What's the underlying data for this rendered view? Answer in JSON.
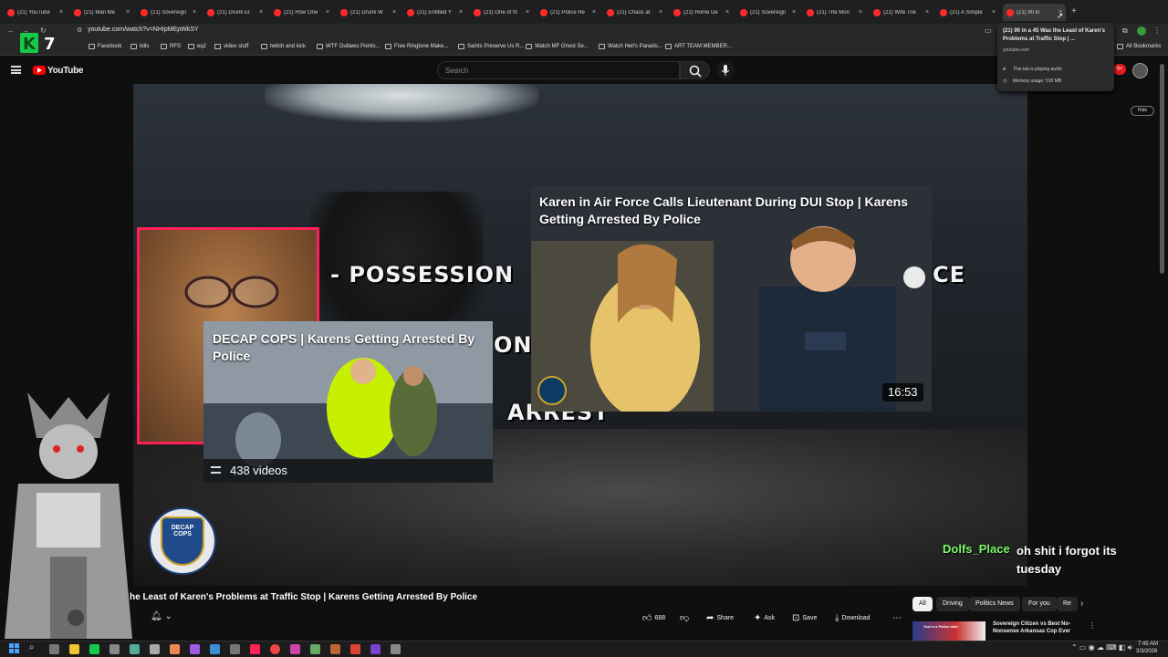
{
  "browser": {
    "tabs": [
      {
        "title": "(21) YouTube"
      },
      {
        "title": "(21) Man Me"
      },
      {
        "title": "(21) Sovereign"
      },
      {
        "title": "(21) Drunk Er"
      },
      {
        "title": "(21) How One"
      },
      {
        "title": "(21) Drunk W"
      },
      {
        "title": "(21) Entitled Y"
      },
      {
        "title": "(21) One of th"
      },
      {
        "title": "(21) Police Re"
      },
      {
        "title": "(21) Chaos at"
      },
      {
        "title": "(21) Home De"
      },
      {
        "title": "(21) Sovereign"
      },
      {
        "title": "(21) The Mon"
      },
      {
        "title": "(21) Wife Trie"
      },
      {
        "title": "(21) A Simple"
      },
      {
        "title": "(21) 90 in"
      }
    ],
    "url": "youtube.com/watch?v=NHIpMEpWkSY",
    "bookmarks": [
      "Facebook",
      "bills",
      "RFS",
      "eq2",
      "video stuff",
      "twitch and kick",
      "WTF Outlaws Points...",
      "Free Ringtone Make...",
      "Saints Preserve Us R...",
      "Watch MF Ghost Se...",
      "Watch Hell's Paradis...",
      "ART TEAM MEMBER..."
    ],
    "all_bookmarks": "All Bookmarks",
    "overlay_logo": "K7"
  },
  "tooltip": {
    "title": "(21) 90 in a 45 Was the Least of Karen's Problems at Traffic Stop | ...",
    "url": "youtube.com",
    "audio": "This tab is playing audio",
    "memory": "Memory usage: 518 MB"
  },
  "youtube": {
    "brand": "YouTube",
    "search_placeholder": "Search",
    "hide_label": "Hide",
    "notifications": "9+"
  },
  "video": {
    "overlay_words": [
      "- POSSESSION",
      "ON",
      "ARREST",
      "CE"
    ],
    "endcard_playlist": {
      "title": "DECAP COPS | Karens Getting Arrested By Police",
      "count": "438 videos"
    },
    "endcard_video": {
      "title": "Karen in Air Force Calls Lieutenant During DUI Stop | Karens Getting Arrested By Police",
      "duration": "16:53"
    },
    "channel_badge": "DECAP COPS",
    "title": "he Least of Karen's Problems at Traffic Stop | Karens Getting Arrested By Police"
  },
  "chat": {
    "user": "Dolfs_Place",
    "message": "oh shit i forgot its tuesday"
  },
  "actions": {
    "likes": "688",
    "share": "Share",
    "ask": "Ask",
    "save": "Save",
    "download": "Download"
  },
  "chips": [
    "All",
    "Driving",
    "Politics News",
    "For you",
    "Re"
  ],
  "recommendation": {
    "title": "Sovereign Citizen vs Best No-Nonsense Arkansas Cop Ever",
    "thumb_text": "You're a Police Idiot"
  },
  "clock": {
    "time": "7:45 AM",
    "date": "3/3/2026"
  },
  "colors": {
    "accent": "#ff0000",
    "chat_user": "#7df76a",
    "pip_border": "#ff1f5a"
  }
}
